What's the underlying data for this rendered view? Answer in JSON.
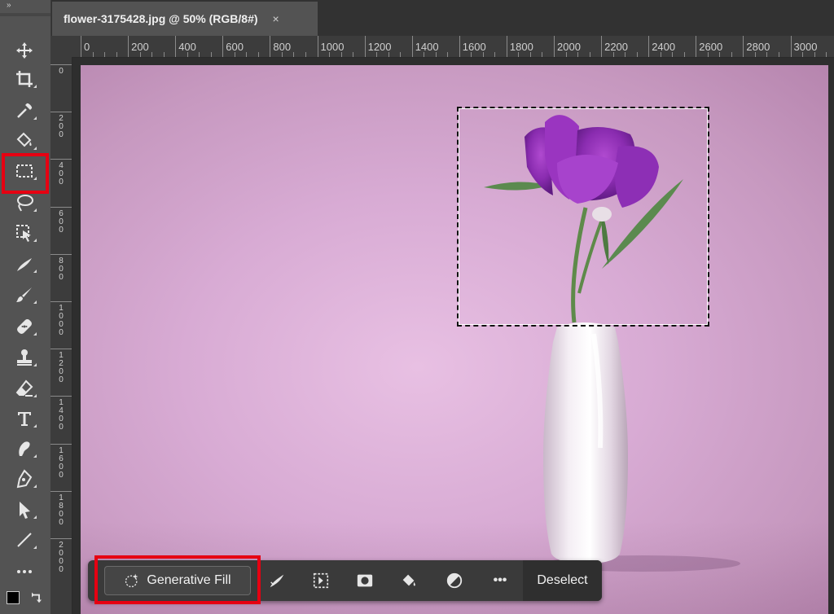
{
  "document_tab": {
    "title": "flower-3175428.jpg @ 50% (RGB/8#)",
    "close_symbol": "×"
  },
  "toolbar": {
    "collapse_label": "»",
    "tools": [
      {
        "name": "move-icon"
      },
      {
        "name": "crop-icon"
      },
      {
        "name": "eyedropper-icon"
      },
      {
        "name": "paint-bucket-icon"
      },
      {
        "name": "rectangular-marquee-icon",
        "selected": true
      },
      {
        "name": "lasso-icon"
      },
      {
        "name": "object-selection-icon"
      },
      {
        "name": "healing-brush-icon"
      },
      {
        "name": "brush-icon"
      },
      {
        "name": "spot-healing-icon"
      },
      {
        "name": "clone-stamp-icon"
      },
      {
        "name": "eraser-icon"
      },
      {
        "name": "type-icon"
      },
      {
        "name": "smudge-icon"
      },
      {
        "name": "pen-icon"
      },
      {
        "name": "path-selection-icon"
      },
      {
        "name": "line-icon"
      },
      {
        "name": "more-tools-icon"
      }
    ],
    "highlight_color": "#e60012"
  },
  "ruler_top": {
    "labels": [
      "0",
      "200",
      "400",
      "600",
      "800",
      "1000",
      "1200",
      "1400",
      "1600",
      "1800",
      "2000",
      "2200",
      "2400",
      "2600",
      "2800",
      "3000"
    ]
  },
  "ruler_left": {
    "labels": [
      "0",
      "200",
      "400",
      "600",
      "800",
      "1000",
      "1200",
      "1400",
      "1600",
      "1800",
      "2000"
    ]
  },
  "context_bar": {
    "generative_fill_label": "Generative Fill",
    "deselect_label": "Deselect",
    "icons": [
      "modify-selection-icon",
      "select-subject-icon",
      "mask-icon",
      "fill-icon",
      "invert-icon",
      "more-options-icon"
    ],
    "more_symbol": "•••"
  },
  "colors": {
    "canvas_bg": "#d8abd4",
    "toolbar_bg": "#535353",
    "highlight": "#e60012"
  }
}
